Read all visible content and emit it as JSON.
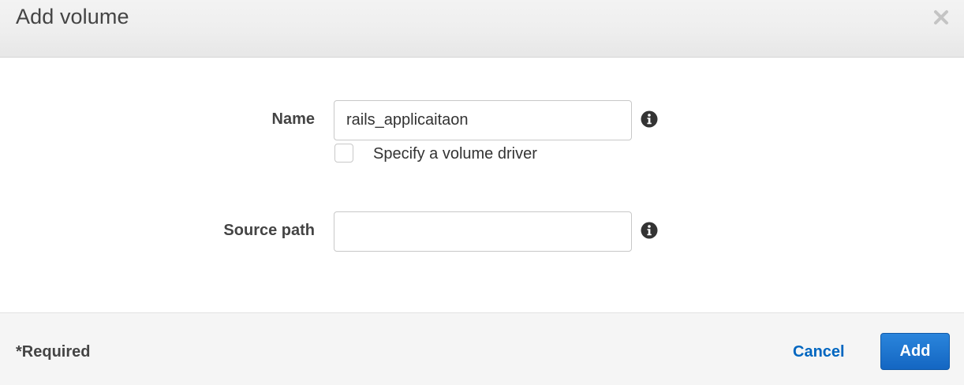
{
  "dialog": {
    "title": "Add volume",
    "close_icon": "close-icon"
  },
  "form": {
    "name": {
      "label": "Name",
      "value": "rails_applicaitaon",
      "info_icon": "info-icon"
    },
    "volume_driver": {
      "label": "Specify a volume driver",
      "checked": false
    },
    "source_path": {
      "label": "Source path",
      "value": "",
      "info_icon": "info-icon"
    }
  },
  "footer": {
    "required_note": "*Required",
    "cancel_label": "Cancel",
    "add_label": "Add"
  },
  "colors": {
    "primary": "#1a73cf",
    "link": "#0066c0",
    "header_bg": "#eeeeee",
    "footer_bg": "#f5f5f5"
  }
}
